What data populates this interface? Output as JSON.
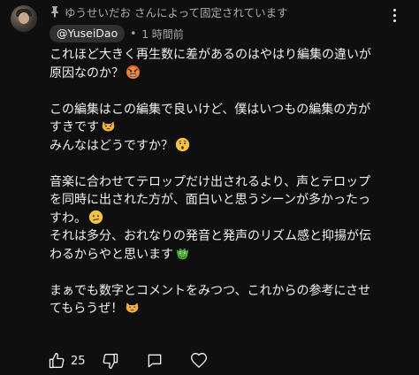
{
  "comment": {
    "pinned_text": "ゆうせいだお さんによって固定されています",
    "author": "@YuseiDao",
    "separator": "•",
    "timestamp": "1 時間前",
    "lines": [
      "これほど大きく再生数に差があるのはやはり編集の違いが",
      "原因なのか？",
      "",
      "この編集はこの編集で良いけど、僕はいつもの編集の方が",
      "すきです",
      "みんなはどうですか？",
      "",
      "音楽に合わせてテロップだけ出されるより、声とテロップ",
      "を同時に出された方が、面白いと思うシーンが多かったっ",
      "すわ。",
      "それは多分、おれなりの発音と発声のリズム感と抑揚が伝",
      "わるからやと思います",
      "",
      "まぁでも数字とコメントをみつつ、これからの参考にさせ",
      "てもらうぜ！"
    ],
    "emojis": {
      "line2": "angry-face-emoji",
      "line5": "cat-face-emoji",
      "line6": "hushed-face-emoji",
      "line9": "confused-face-emoji",
      "line12": "dragon-face-emoji",
      "line15": "cat-smile-emoji"
    },
    "like_count": "25",
    "accent": "#f1f1f1",
    "secondary": "#aaaaaa"
  }
}
